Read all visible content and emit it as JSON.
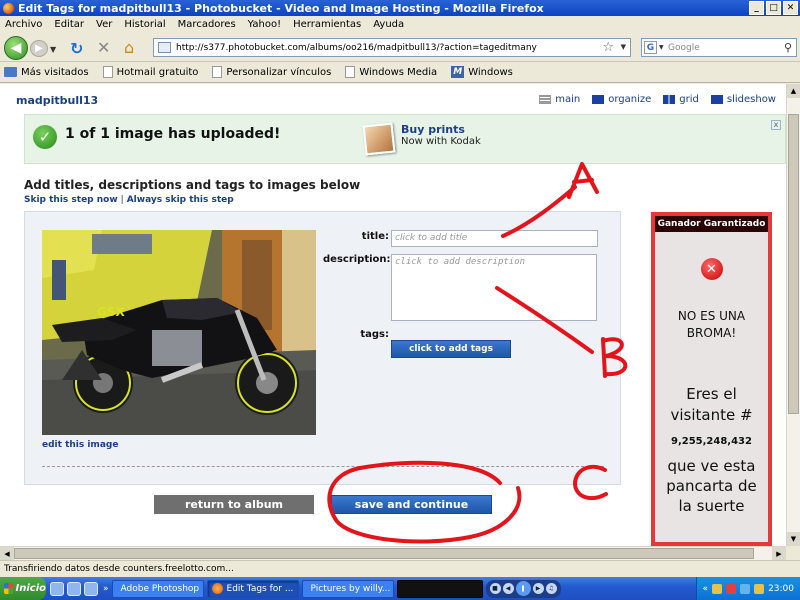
{
  "window": {
    "title": "Edit Tags for madpitbull13 - Photobucket - Video and Image Hosting - Mozilla Firefox",
    "min": "_",
    "max": "□",
    "close": "✕"
  },
  "menu": [
    "Archivo",
    "Editar",
    "Ver",
    "Historial",
    "Marcadores",
    "Yahoo!",
    "Herramientas",
    "Ayuda"
  ],
  "nav": {
    "url": "http://s377.photobucket.com/albums/oo216/madpitbull13/?action=tageditmany",
    "search_placeholder": "Google",
    "search_engine_letter": "G"
  },
  "bookmarks": [
    "Más visitados",
    "Hotmail gratuito",
    "Personalizar vínculos",
    "Windows Media",
    "Windows"
  ],
  "page": {
    "username": "madpitbull13",
    "views": [
      "main",
      "organize",
      "grid",
      "slideshow"
    ],
    "banner": {
      "message": "1 of 1 image has uploaded!",
      "buy_prints": "Buy prints",
      "kodak": "Now with Kodak",
      "close": "x"
    },
    "heading": "Add titles, descriptions and tags to images below",
    "skip_now": "Skip this step now",
    "skip_sep": "|",
    "skip_always": "Always skip this step",
    "form": {
      "title_label": "title:",
      "title_placeholder": "click to add title",
      "desc_label": "description:",
      "desc_placeholder": "click to add description",
      "tags_label": "tags:",
      "tags_button": "click to add tags",
      "edit_image": "edit this image"
    },
    "return_button": "return to album",
    "save_button": "save and continue"
  },
  "ad": {
    "header": "Ganador Garantizado",
    "line1a": "NO ES UNA",
    "line1b": "BROMA!",
    "line2a": "Eres el",
    "line2b": "visitante #",
    "number": "9,255,248,432",
    "line3a": "que ve esta",
    "line3b": "pancarta de",
    "line3c": "la suerte"
  },
  "annotations": [
    "A",
    "B",
    "C"
  ],
  "status": "Transfiriendo datos desde counters.freelotto.com...",
  "taskbar": {
    "start": "Inicio",
    "more": "»",
    "tasks": [
      "Adobe Photoshop",
      "Edit Tags for ...",
      "Pictures by willy..."
    ],
    "clock": "23:00",
    "tray_more": "«"
  },
  "colors": {
    "link_blue": "#1a3f88",
    "button_blue": "#1e56a8",
    "annotation_red": "#e3141b",
    "ad_border": "#e23a3a"
  }
}
